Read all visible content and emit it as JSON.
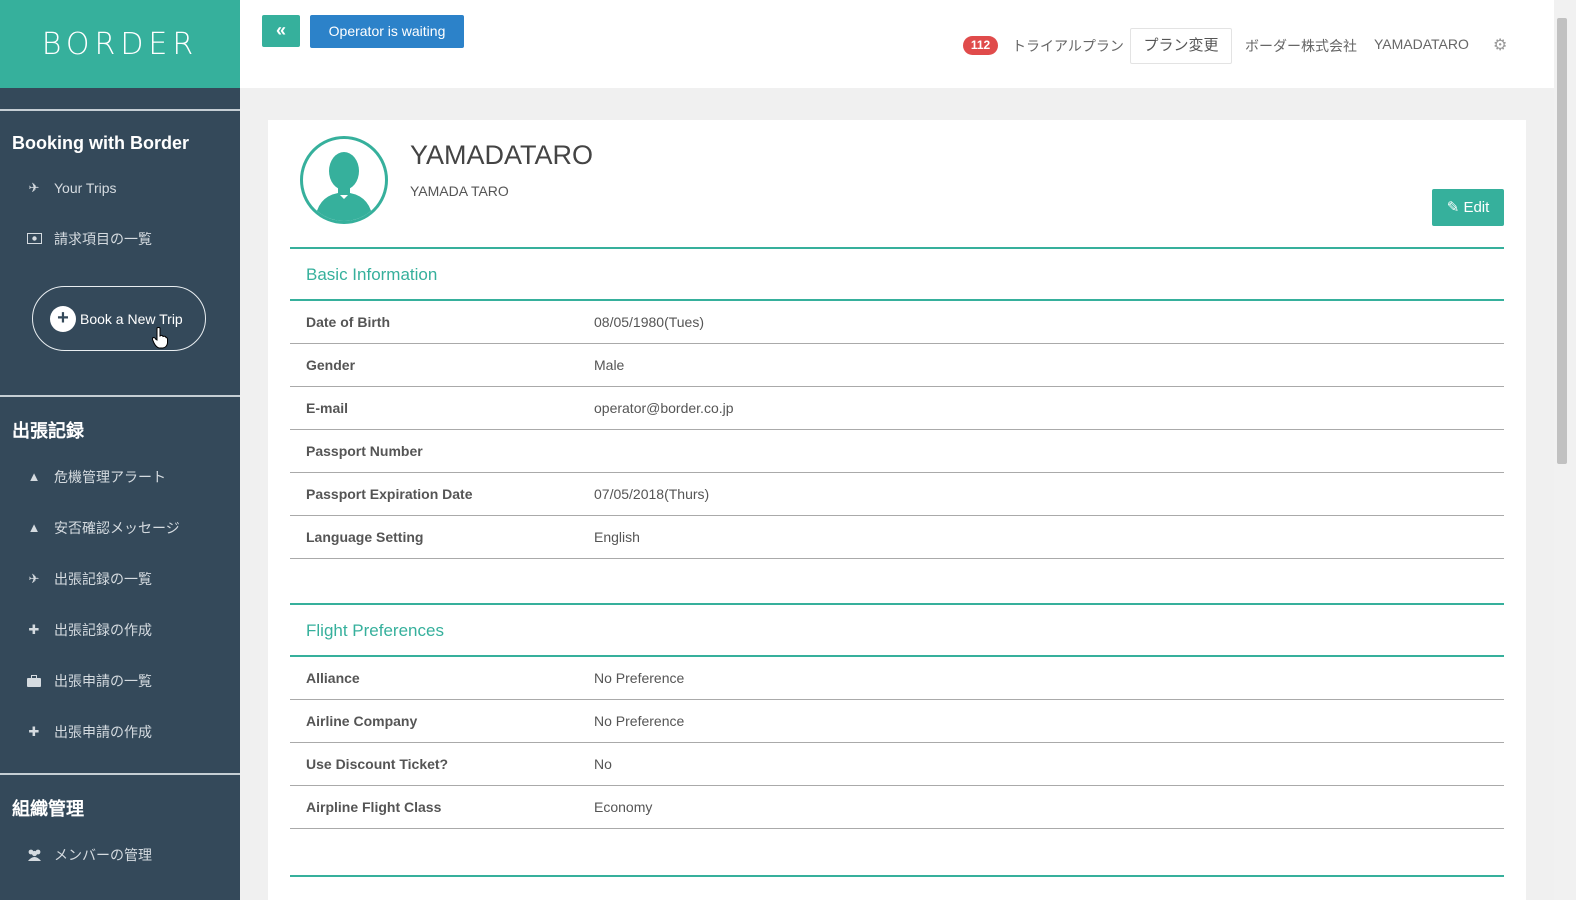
{
  "sidebar": {
    "logo": "BORDER",
    "section1": {
      "heading": "Booking with Border",
      "items": [
        {
          "label": "Your Trips",
          "icon": "plane-icon"
        },
        {
          "label": "請求項目の一覧",
          "icon": "money-icon"
        }
      ]
    },
    "book_button": "Book a New Trip",
    "section2": {
      "heading": "出張記録",
      "items": [
        {
          "label": "危機管理アラート",
          "icon": "warning-icon"
        },
        {
          "label": "安否確認メッセージ",
          "icon": "warning-icon"
        },
        {
          "label": "出張記録の一覧",
          "icon": "plane-icon"
        },
        {
          "label": "出張記録の作成",
          "icon": "plus-icon"
        },
        {
          "label": "出張申請の一覧",
          "icon": "briefcase-icon"
        },
        {
          "label": "出張申請の作成",
          "icon": "plus-icon"
        }
      ]
    },
    "section3": {
      "heading": "組織管理",
      "items": [
        {
          "label": "メンバーの管理",
          "icon": "users-icon"
        }
      ]
    }
  },
  "topbar": {
    "back_label": "«",
    "operator_label": "Operator is waiting",
    "badge_count": "112",
    "trial_label": "トライアルプラン",
    "plan_change_label": "プラン変更",
    "company": "ボーダー株式会社",
    "username": "YAMADATARO"
  },
  "profile": {
    "name": "YAMADATARO",
    "subname": "YAMADA TARO",
    "edit_label": "Edit"
  },
  "basic_info": {
    "title": "Basic Information",
    "rows": [
      {
        "label": "Date of Birth",
        "value": "08/05/1980(Tues)"
      },
      {
        "label": "Gender",
        "value": "Male"
      },
      {
        "label": "E-mail",
        "value": "operator@border.co.jp"
      },
      {
        "label": "Passport Number",
        "value": ""
      },
      {
        "label": "Passport Expiration Date",
        "value": "07/05/2018(Thurs)"
      },
      {
        "label": "Language Setting",
        "value": "English"
      }
    ]
  },
  "flight_prefs": {
    "title": "Flight Preferences",
    "rows": [
      {
        "label": "Alliance",
        "value": "No Preference"
      },
      {
        "label": "Airline Company",
        "value": "No Preference"
      },
      {
        "label": "Use Discount Ticket?",
        "value": "No"
      },
      {
        "label": "Airpline Flight Class",
        "value": "Economy"
      }
    ]
  },
  "colors": {
    "accent": "#36b09c",
    "sidebar": "#34495a",
    "operator_button": "#2c82c9",
    "badge": "#e04b4b"
  }
}
